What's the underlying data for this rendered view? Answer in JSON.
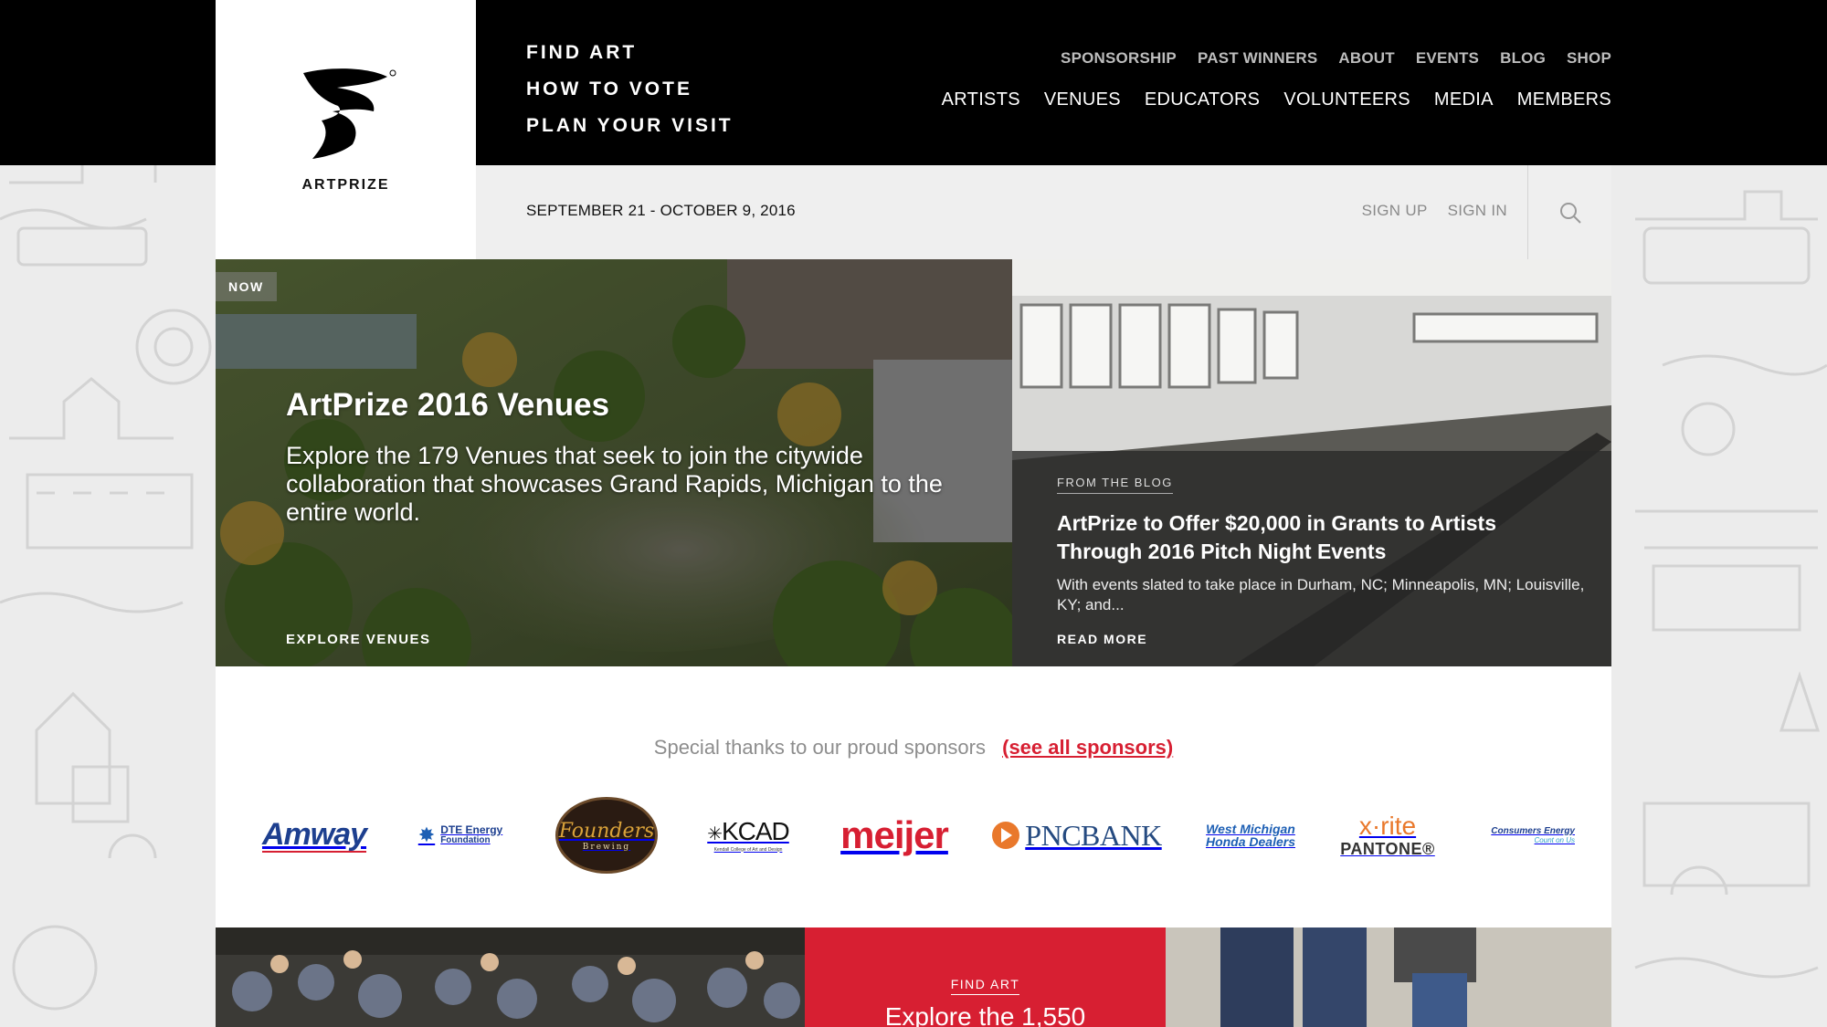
{
  "brand": {
    "name": "ARTPRIZE"
  },
  "primary_nav": [
    "FIND ART",
    "HOW TO VOTE",
    "PLAN YOUR VISIT"
  ],
  "utility_nav": [
    "SPONSORSHIP",
    "PAST WINNERS",
    "ABOUT",
    "EVENTS",
    "BLOG",
    "SHOP"
  ],
  "main_nav": [
    "ARTISTS",
    "VENUES",
    "EDUCATORS",
    "VOLUNTEERS",
    "MEDIA",
    "MEMBERS"
  ],
  "subbar": {
    "dates": "SEPTEMBER 21 - OCTOBER 9, 2016",
    "sign_up": "SIGN UP",
    "sign_in": "SIGN IN"
  },
  "hero": {
    "badge": "NOW",
    "title": "ArtPrize 2016 Venues",
    "description": "Explore the 179 Venues that seek to join the citywide collaboration that showcases Grand Rapids, Michigan to the entire world.",
    "link": "EXPLORE VENUES"
  },
  "blog": {
    "kicker": "FROM THE BLOG",
    "title": "ArtPrize to Offer $20,000 in Grants to Artists Through 2016 Pitch Night Events",
    "excerpt": "With events slated to take place in Durham, NC; Minneapolis, MN; Louisville, KY; and...",
    "link": "READ MORE"
  },
  "sponsors": {
    "thanks": "Special thanks to our proud sponsors",
    "see_all": "(see all sponsors)",
    "logos": {
      "amway": "Amway",
      "dte_1": "DTE Energy",
      "dte_2": "Foundation",
      "founders_1": "Founders",
      "founders_2": "Brewing",
      "kcad": "KCAD",
      "kcad_sub": "Kendall College of Art and Design",
      "meijer": "meijer",
      "pnc": "PNCBANK",
      "honda_1": "West Michigan",
      "honda_2": "Honda Dealers",
      "xrite": "x·rite",
      "pantone": "PANTONE®",
      "consumers_1": "Consumers Energy",
      "consumers_2": "Count on Us"
    }
  },
  "bottom": {
    "kicker": "FIND ART",
    "headline": "Explore the 1,550"
  },
  "colors": {
    "accent": "#d71f32",
    "header": "#000000",
    "subbar": "#efefef"
  },
  "icons": [
    "search-icon",
    "artprize-logo-icon"
  ]
}
